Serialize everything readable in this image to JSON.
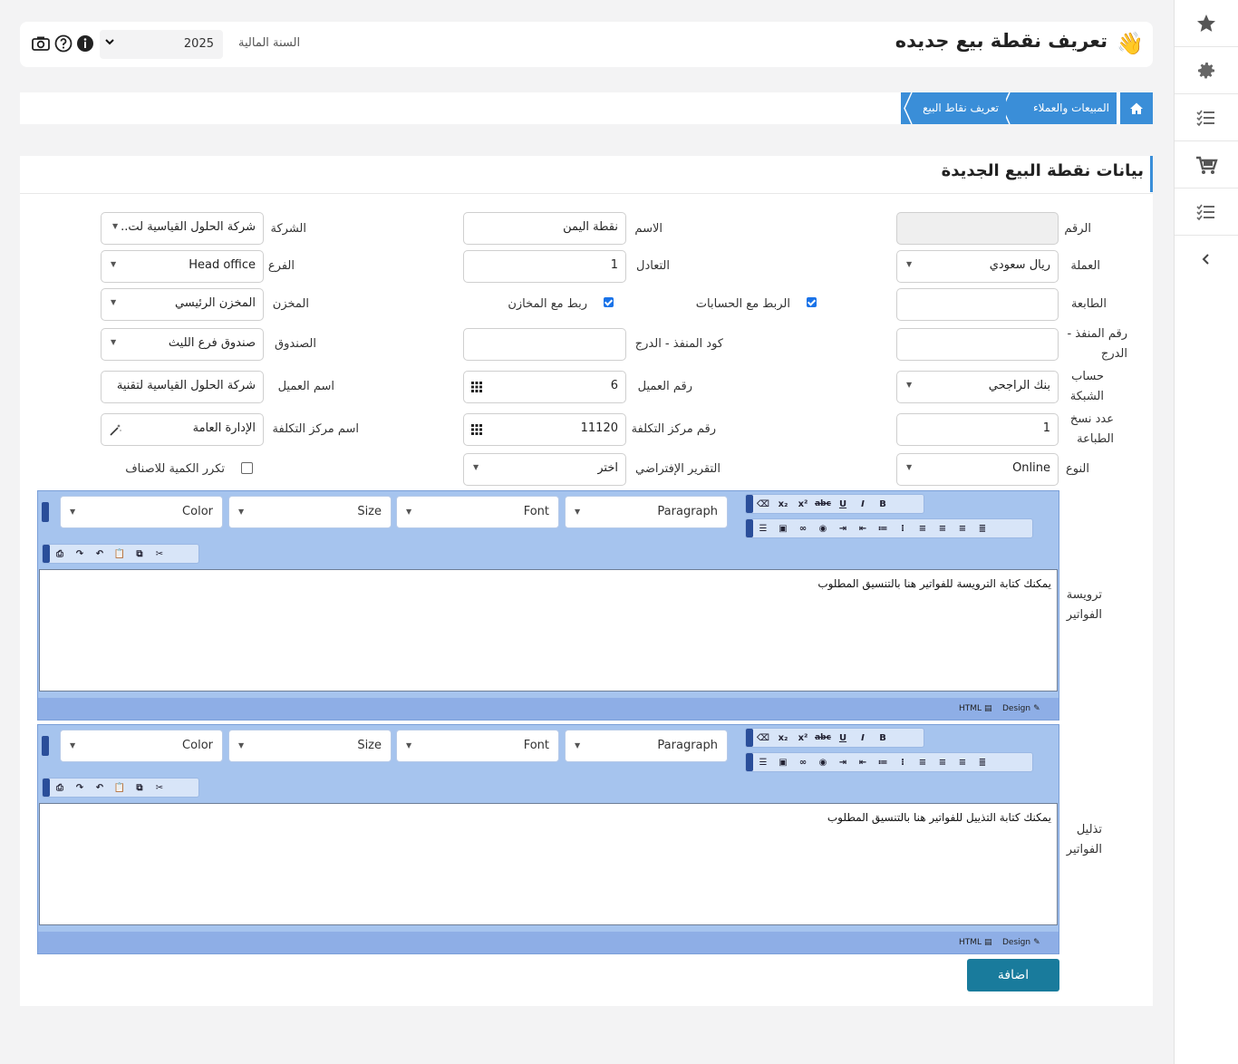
{
  "header": {
    "title": "تعريف نقطة بيع جديده",
    "fiscal_year_label": "السنة المالية",
    "fiscal_year_value": "2025"
  },
  "breadcrumb": [
    "المبيعات والعملاء",
    "تعريف نقاط البيع"
  ],
  "card_title": "بيانات نقطة البيع الجديدة",
  "form": {
    "number_label": "الرقم",
    "number_value": "",
    "name_label": "الاسم",
    "name_value": "نقطة اليمن",
    "company_label": "الشركة",
    "company_value": "شركة الحلول القياسية لت...",
    "currency_label": "العملة",
    "currency_value": "ريال سعودي",
    "rate_label": "التعادل",
    "rate_value": "1",
    "branch_label": "الفرع",
    "branch_value": "Head office",
    "printer_label": "الطابعة",
    "printer_value": "",
    "link_accounts_label": "الربط مع الحسابات",
    "link_stores_label": "ربط مع المخازن",
    "store_label": "المخزن",
    "store_value": "المخزن الرئيسي",
    "port_drawer_num_label": "رقم المنفذ - الدرج",
    "port_drawer_num_value": "",
    "port_drawer_code_label": "كود المنفذ - الدرج",
    "port_drawer_code_value": "",
    "cashbox_label": "الصندوق",
    "cashbox_value": "صندوق فرع الليث",
    "network_account_label": "حساب الشبكة",
    "network_account_value": "بنك الراجحي",
    "customer_num_label": "رقم العميل",
    "customer_num_value": "6",
    "customer_name_label": "اسم العميل",
    "customer_name_value": "شركة الحلول القياسية لتقنية",
    "print_copies_label": "عدد نسخ الطباعة",
    "print_copies_value": "1",
    "cost_center_num_label": "رقم مركز التكلفة",
    "cost_center_num_value": "11120",
    "cost_center_name_label": "اسم مركز التكلفة",
    "cost_center_name_value": "الإدارة العامة",
    "type_label": "النوع",
    "type_value": "Online",
    "default_report_label": "التقرير الإفتراضي",
    "default_report_value": "اختر",
    "repeat_qty_label": "تكرر الكمية للاصناف"
  },
  "editors": {
    "header_label": "ترويسة الفواتير",
    "header_text": "يمكنك كتابة الترويسة للفواتير هنا بالتنسيق المطلوب",
    "footer_label": "تذليل الفواتير",
    "footer_text": "يمكنك كتابة التذييل للفواتير هنا بالتنسيق المطلوب",
    "paragraph": "Paragraph",
    "font": "Font",
    "size": "Size",
    "color": "Color",
    "design": "Design",
    "html": "HTML"
  },
  "add_button": "اضافة",
  "sidebar_icons": [
    "star-icon",
    "gear-icon",
    "checklist-icon",
    "cart-icon",
    "checklist-icon",
    "chevron-left-icon"
  ]
}
